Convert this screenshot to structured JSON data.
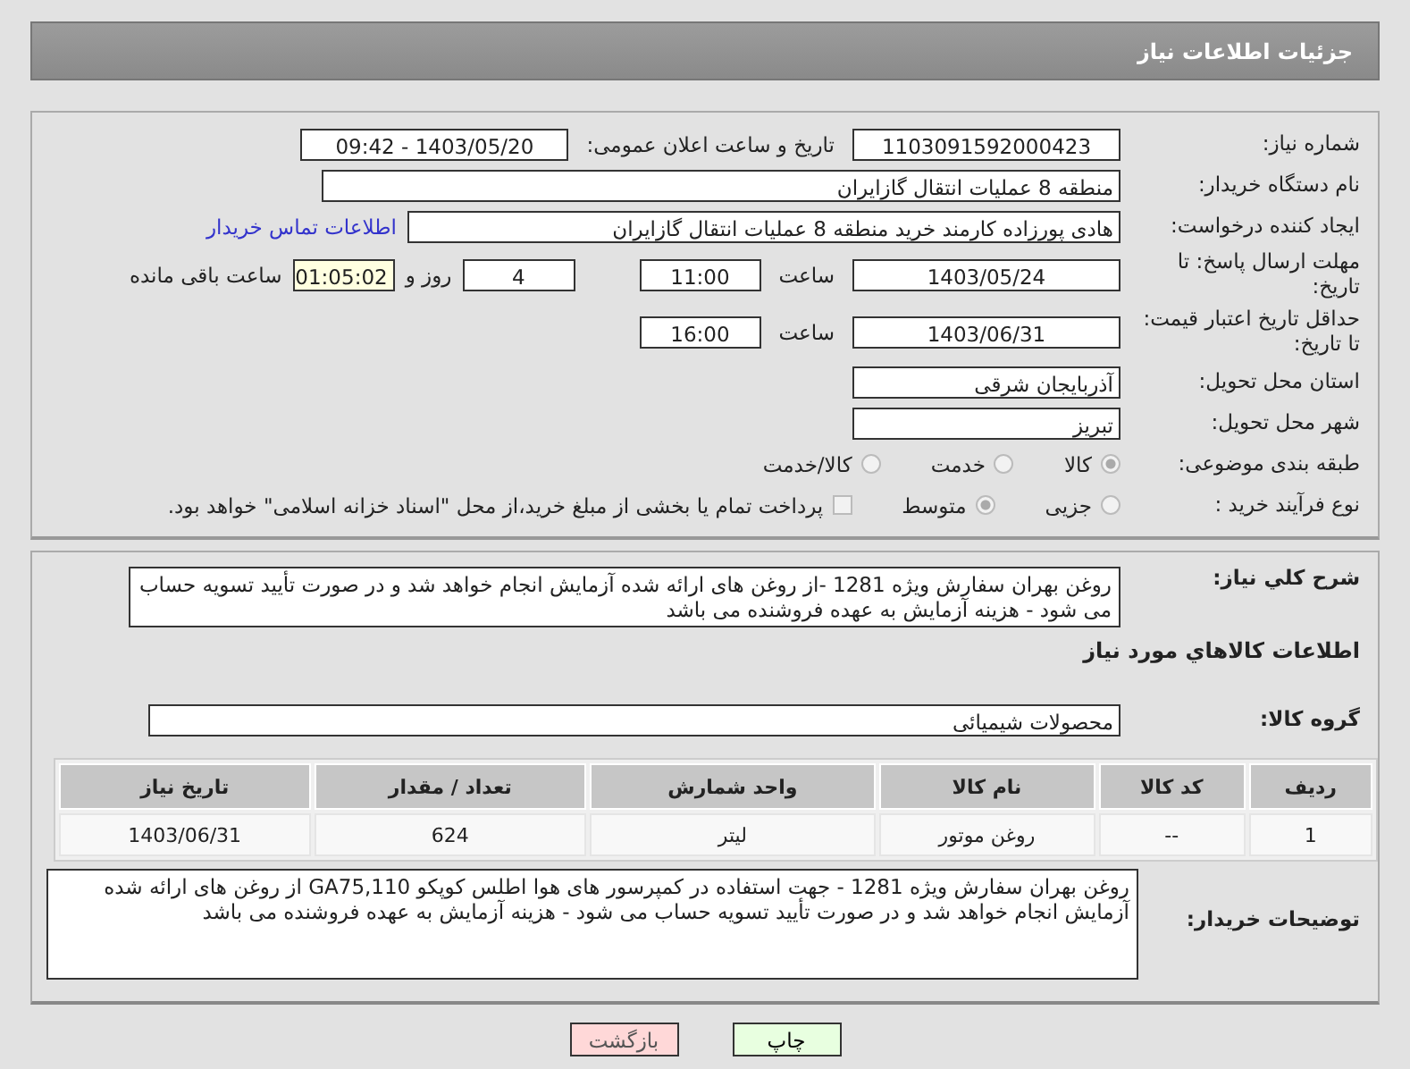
{
  "header": {
    "title": "جزئیات اطلاعات نیاز"
  },
  "need_number": {
    "label": "شماره نیاز:",
    "value": "1103091592000423"
  },
  "announce": {
    "label": "تاریخ و ساعت اعلان عمومی:",
    "value": "1403/05/20 - 09:42"
  },
  "buyer": {
    "label": "نام دستگاه خریدار:",
    "value": "منطقه 8 عملیات انتقال گازایران"
  },
  "creator": {
    "label": "ایجاد کننده درخواست:",
    "value": "هادی پورزاده کارمند خرید منطقه 8 عملیات انتقال گازایران",
    "link": "اطلاعات تماس خریدار"
  },
  "deadline": {
    "label": "مهلت ارسال پاسخ: تا تاریخ:",
    "date": "1403/05/24",
    "time_label": "ساعت",
    "time": "11:00",
    "days": "4",
    "days_label": "روز و",
    "remaining": "01:05:02",
    "remaining_label": "ساعت باقی مانده"
  },
  "validity": {
    "label": "حداقل تاریخ اعتبار قیمت: تا تاریخ:",
    "date": "1403/06/31",
    "time_label": "ساعت",
    "time": "16:00"
  },
  "province": {
    "label": "استان محل تحویل:",
    "value": "آذربایجان شرقی"
  },
  "city": {
    "label": "شهر محل تحویل:",
    "value": "تبریز"
  },
  "category": {
    "label": "طبقه بندی موضوعی:",
    "options": [
      {
        "label": "کالا",
        "selected": true
      },
      {
        "label": "خدمت",
        "selected": false
      },
      {
        "label": "کالا/خدمت",
        "selected": false
      }
    ]
  },
  "process": {
    "label": "نوع فرآیند خرید :",
    "options": [
      {
        "label": "جزیی",
        "selected": false
      },
      {
        "label": "متوسط",
        "selected": true
      }
    ],
    "payment": {
      "label": "پرداخت تمام یا بخشی از مبلغ خرید،از محل \"اسناد خزانه اسلامی\" خواهد بود.",
      "checked": false
    }
  },
  "summary": {
    "label": "شرح كلي نياز:",
    "value": "روغن بهران سفارش ویژه 1281 -از روغن های ارائه شده آزمایش انجام خواهد شد و در صورت تأیید تسویه حساب می شود - هزینه آزمایش به عهده فروشنده می باشد"
  },
  "goods": {
    "title": "اطلاعات كالاهاي مورد نياز",
    "group_label": "گروه کالا:",
    "group": "محصولات شیمیائی",
    "columns": [
      "ردیف",
      "کد کالا",
      "نام کالا",
      "واحد شمارش",
      "تعداد / مقدار",
      "تاریخ نیاز"
    ],
    "rows": [
      [
        "1",
        "--",
        "روغن موتور",
        "لیتر",
        "624",
        "1403/06/31"
      ]
    ]
  },
  "notes": {
    "label": "توضیحات خریدار:",
    "value": "روغن بهران سفارش ویژه 1281 - جهت استفاده در کمپرسور های هوا اطلس کوپکو GA75,110 از روغن های ارائه شده آزمایش انجام خواهد شد و در صورت تأیید تسویه حساب می شود - هزینه آزمایش به عهده فروشنده می باشد"
  },
  "buttons": [
    {
      "label": "چاپ",
      "kind": "print"
    },
    {
      "label": "بازگشت",
      "kind": "back"
    }
  ]
}
